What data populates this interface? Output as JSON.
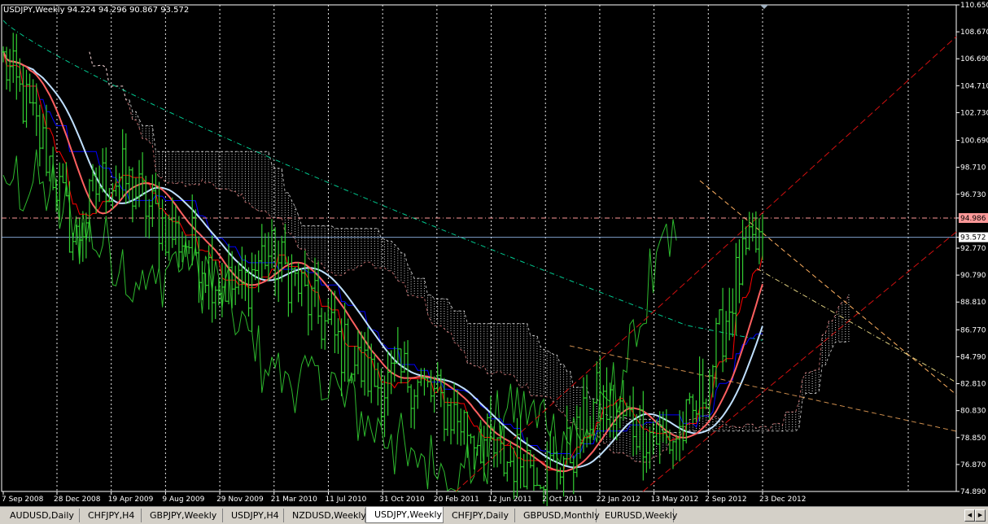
{
  "chart": {
    "header": "USDJPY,Weekly  94.224 94.296 90.867 93.572",
    "symbol": "USDJPY",
    "timeframe": "Weekly",
    "ohlc": {
      "open": 94.224,
      "high": 94.296,
      "low": 90.867,
      "close": 93.572
    },
    "price_axis_labels": [
      "110.650",
      "108.670",
      "106.690",
      "104.710",
      "102.730",
      "100.690",
      "98.710",
      "96.730",
      "94.986",
      "93.572",
      "92.770",
      "90.790",
      "88.810",
      "86.770",
      "84.790",
      "82.810",
      "80.830",
      "78.850",
      "76.870",
      "74.890"
    ],
    "current_price": "93.572",
    "level_line": "94.986",
    "time_axis_labels": [
      "7 Sep 2008",
      "28 Dec 2008",
      "19 Apr 2009",
      "9 Aug 2009",
      "29 Nov 2009",
      "21 Mar 2010",
      "11 Jul 2010",
      "31 Oct 2010",
      "20 Feb 2011",
      "12 Jun 2011",
      "2 Oct 2011",
      "22 Jan 2012",
      "13 May 2012",
      "2 Sep 2012",
      "23 Dec 2012"
    ],
    "colors": {
      "background": "#000000",
      "price": "#32cd32",
      "grid": "#ffffff",
      "kumo": "#ffffff",
      "tenkan": "#ff0000",
      "kijun": "#0000ff",
      "smooth_red": "#ff6060",
      "smooth_white": "#c0e0ff",
      "ma_long": "#00e0a0",
      "channel_red": "#d01010",
      "channel_orange": "#ffb060",
      "level": "#ff9999",
      "current_line": "#a0c8ff"
    }
  },
  "chart_data": {
    "type": "candlestick",
    "ylim": [
      74.89,
      110.65
    ],
    "x_labels": [
      "7 Sep 2008",
      "28 Dec 2008",
      "19 Apr 2009",
      "9 Aug 2009",
      "29 Nov 2009",
      "21 Mar 2010",
      "11 Jul 2010",
      "31 Oct 2010",
      "20 Feb 2011",
      "12 Jun 2011",
      "2 Oct 2011",
      "22 Jan 2012",
      "13 May 2012",
      "2 Sep 2012",
      "23 Dec 2012"
    ],
    "close_trend": [
      106.5,
      103.0,
      99.0,
      93.0,
      97.5,
      98.0,
      96.0,
      94.0,
      93.0,
      90.5,
      89.5,
      92.5,
      91.0,
      88.5,
      86.0,
      84.0,
      82.5,
      83.5,
      82.0,
      80.5,
      79.0,
      77.0,
      77.5,
      76.5,
      78.0,
      81.5,
      80.5,
      79.5,
      78.5,
      80.0,
      85.0,
      91.0,
      93.572
    ],
    "current_close": 93.572
  },
  "tabs": [
    {
      "label": "AUDUSD,Daily",
      "active": false
    },
    {
      "label": "CHFJPY,H4",
      "active": false
    },
    {
      "label": "GBPJPY,Weekly",
      "active": false
    },
    {
      "label": "USDJPY,H4",
      "active": false
    },
    {
      "label": "NZDUSD,Weekly",
      "active": false
    },
    {
      "label": "USDJPY,Weekly",
      "active": true
    },
    {
      "label": "CHFJPY,Daily",
      "active": false
    },
    {
      "label": "GBPUSD,Monthly",
      "active": false
    },
    {
      "label": "EURUSD,Weekly",
      "active": false
    }
  ]
}
